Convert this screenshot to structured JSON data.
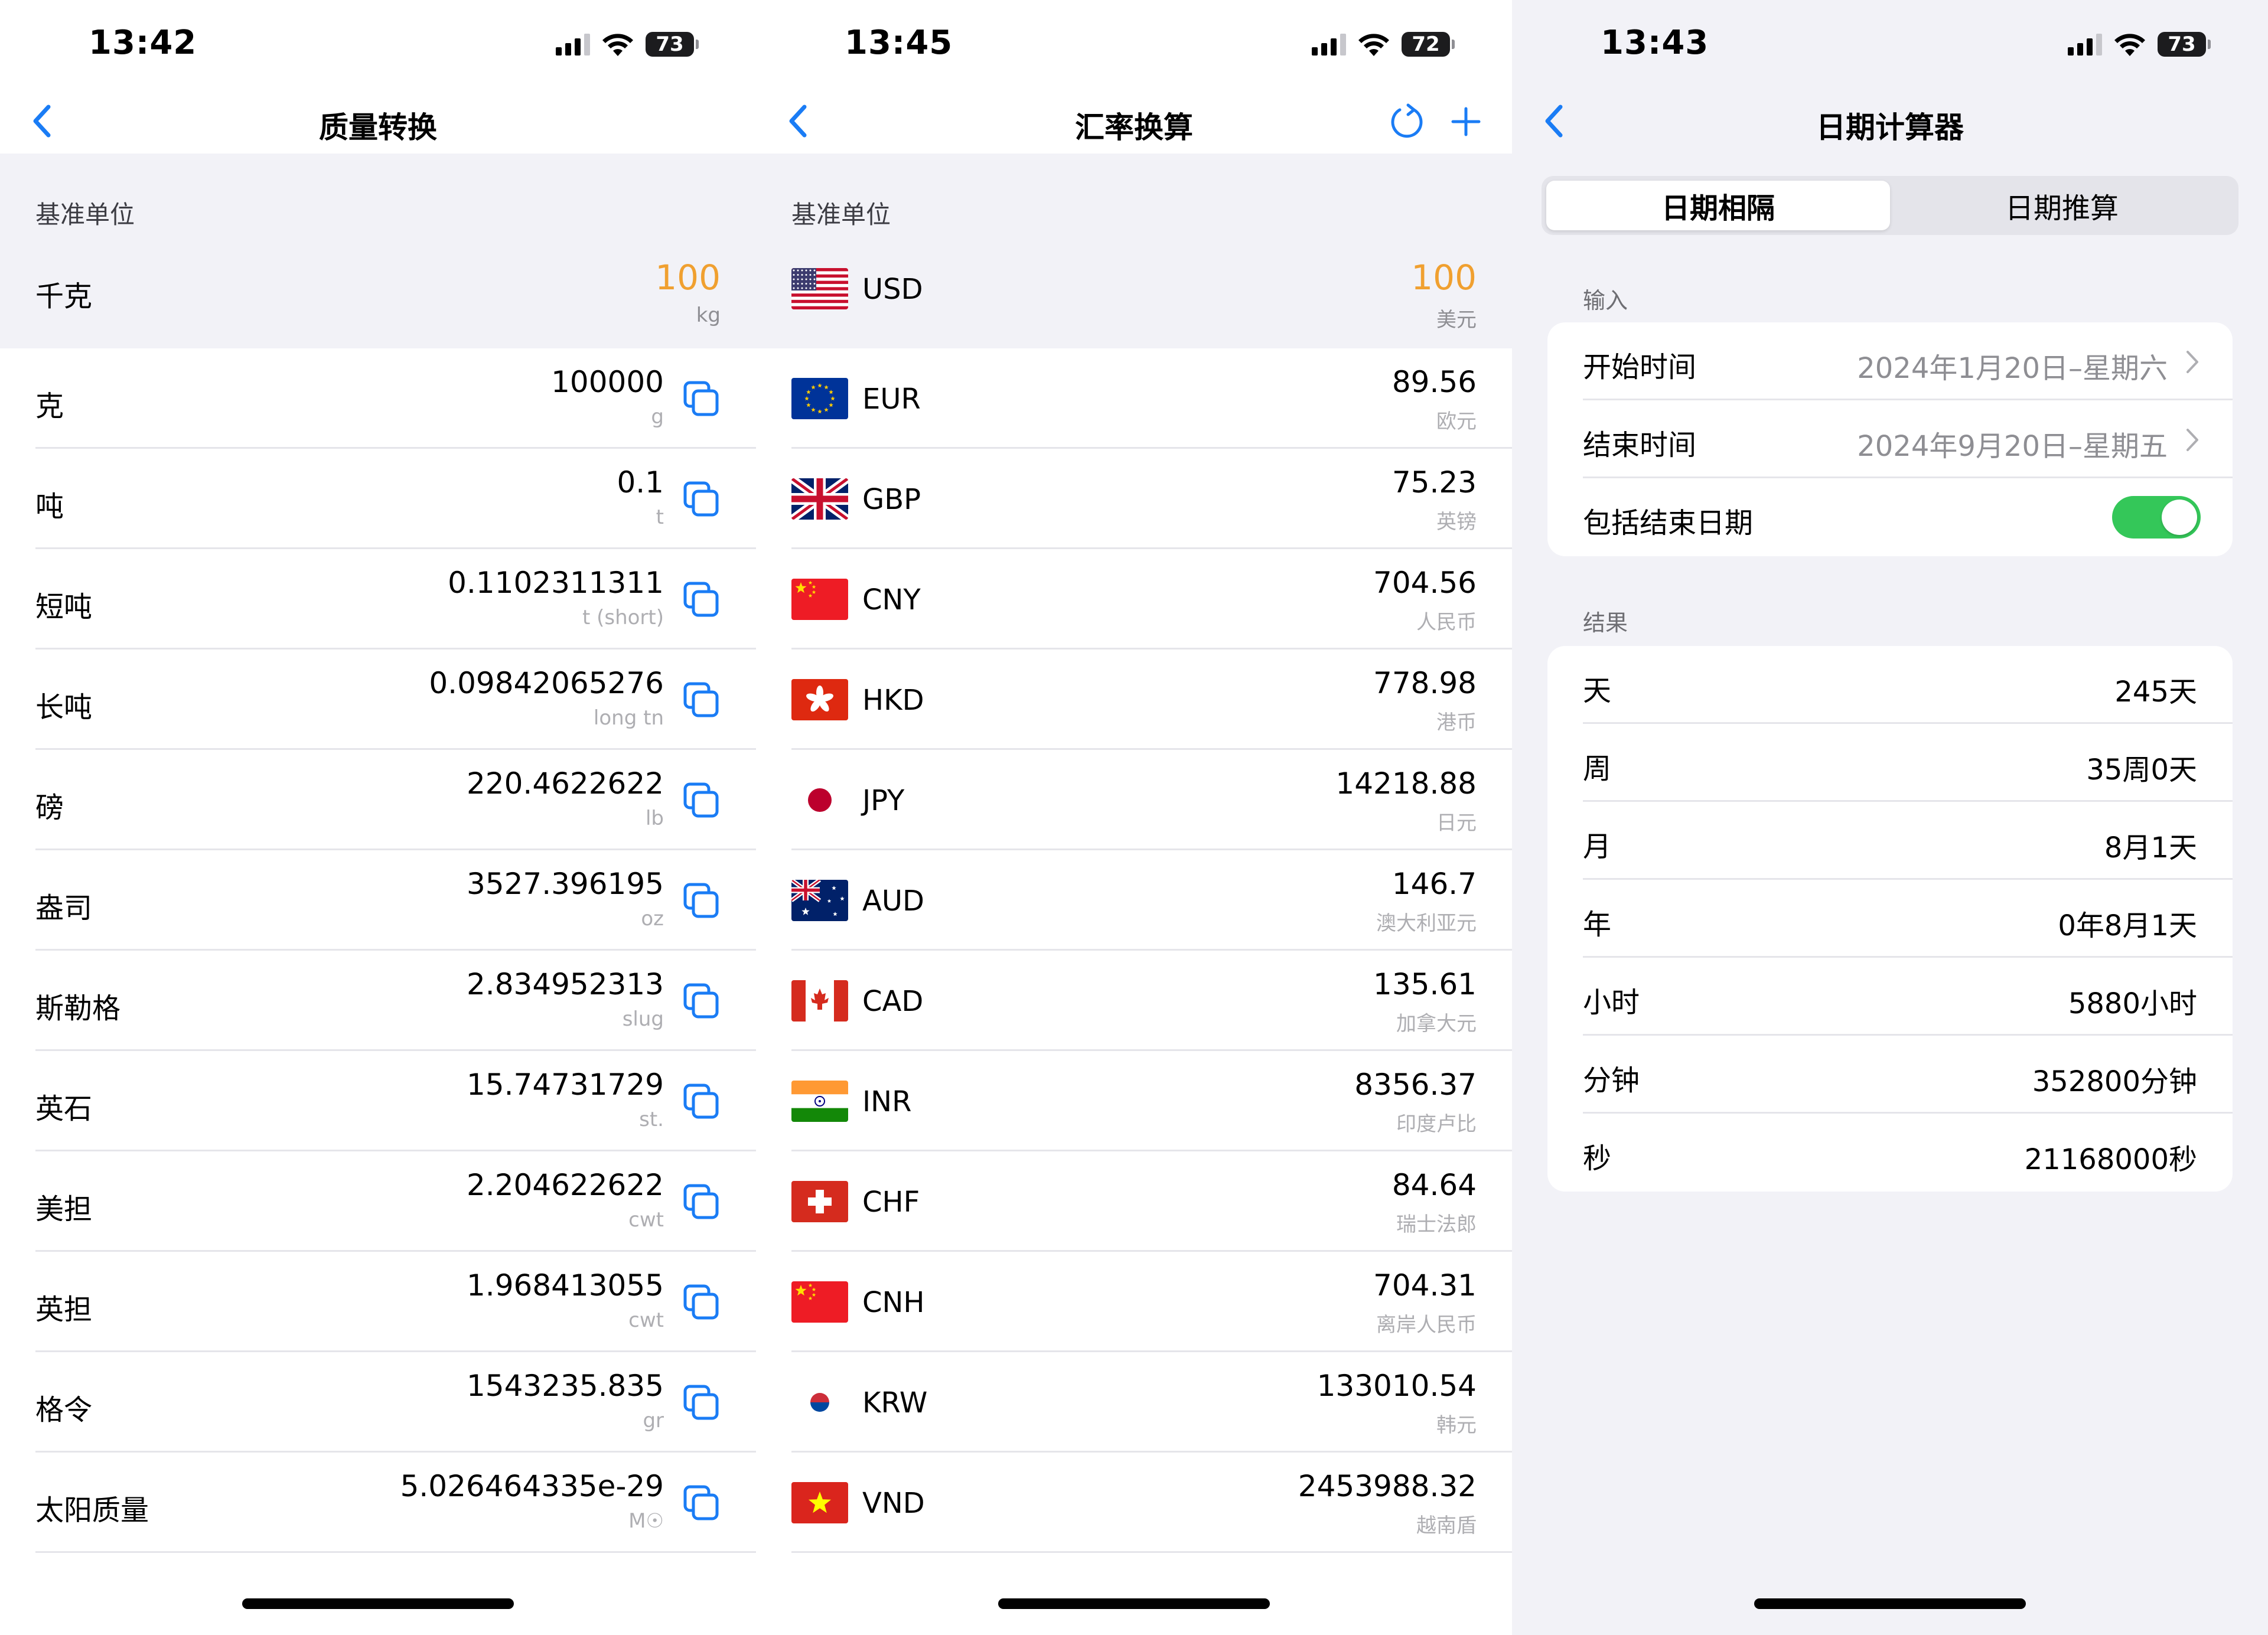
{
  "colors": {
    "accent": "#1a7cf5",
    "highlight": "#f0a030",
    "toggle_on": "#34c759"
  },
  "mass": {
    "status": {
      "time": "13:42",
      "battery": "73"
    },
    "title": "质量转换",
    "section_label": "基准单位",
    "base": {
      "name": "千克",
      "value": "100",
      "unit": "kg"
    },
    "rows": [
      {
        "name": "克",
        "value": "100000",
        "unit": "g"
      },
      {
        "name": "吨",
        "value": "0.1",
        "unit": "t"
      },
      {
        "name": "短吨",
        "value": "0.1102311311",
        "unit": "t (short)"
      },
      {
        "name": "长吨",
        "value": "0.09842065276",
        "unit": "long tn"
      },
      {
        "name": "磅",
        "value": "220.4622622",
        "unit": "lb"
      },
      {
        "name": "盎司",
        "value": "3527.396195",
        "unit": "oz"
      },
      {
        "name": "斯勒格",
        "value": "2.834952313",
        "unit": "slug"
      },
      {
        "name": "英石",
        "value": "15.74731729",
        "unit": "st."
      },
      {
        "name": "美担",
        "value": "2.204622622",
        "unit": "cwt"
      },
      {
        "name": "英担",
        "value": "1.968413055",
        "unit": "cwt"
      },
      {
        "name": "格令",
        "value": "1543235.835",
        "unit": "gr"
      },
      {
        "name": "太阳质量",
        "value": "5.026464335e-29",
        "unit": "M☉"
      }
    ]
  },
  "fx": {
    "status": {
      "time": "13:45",
      "battery": "72"
    },
    "title": "汇率换算",
    "section_label": "基准单位",
    "base": {
      "code": "USD",
      "value": "100",
      "unit": "美元",
      "flag": "us-flag"
    },
    "rows": [
      {
        "code": "EUR",
        "value": "89.56",
        "unit": "欧元",
        "flag": "eu-flag"
      },
      {
        "code": "GBP",
        "value": "75.23",
        "unit": "英镑",
        "flag": "uk-flag"
      },
      {
        "code": "CNY",
        "value": "704.56",
        "unit": "人民币",
        "flag": "cn-flag"
      },
      {
        "code": "HKD",
        "value": "778.98",
        "unit": "港币",
        "flag": "hk-flag"
      },
      {
        "code": "JPY",
        "value": "14218.88",
        "unit": "日元",
        "flag": "jp-flag"
      },
      {
        "code": "AUD",
        "value": "146.7",
        "unit": "澳大利亚元",
        "flag": "au-flag"
      },
      {
        "code": "CAD",
        "value": "135.61",
        "unit": "加拿大元",
        "flag": "ca-flag"
      },
      {
        "code": "INR",
        "value": "8356.37",
        "unit": "印度卢比",
        "flag": "in-flag"
      },
      {
        "code": "CHF",
        "value": "84.64",
        "unit": "瑞士法郎",
        "flag": "ch-flag"
      },
      {
        "code": "CNH",
        "value": "704.31",
        "unit": "离岸人民币",
        "flag": "cn-flag"
      },
      {
        "code": "KRW",
        "value": "133010.54",
        "unit": "韩元",
        "flag": "kr-flag"
      },
      {
        "code": "VND",
        "value": "2453988.32",
        "unit": "越南盾",
        "flag": "vn-flag"
      }
    ]
  },
  "date": {
    "status": {
      "time": "13:43",
      "battery": "73"
    },
    "title": "日期计算器",
    "tabs": [
      "日期相隔",
      "日期推算"
    ],
    "input_label": "输入",
    "start": {
      "label": "开始时间",
      "value": "2024年1月20日–星期六"
    },
    "end": {
      "label": "结束时间",
      "value": "2024年9月20日–星期五"
    },
    "include_end": {
      "label": "包括结束日期",
      "on": true
    },
    "result_label": "结果",
    "results": [
      {
        "label": "天",
        "value": "245天"
      },
      {
        "label": "周",
        "value": "35周0天"
      },
      {
        "label": "月",
        "value": "8月1天"
      },
      {
        "label": "年",
        "value": "0年8月1天"
      },
      {
        "label": "小时",
        "value": "5880小时"
      },
      {
        "label": "分钟",
        "value": "352800分钟"
      },
      {
        "label": "秒",
        "value": "21168000秒"
      }
    ]
  }
}
